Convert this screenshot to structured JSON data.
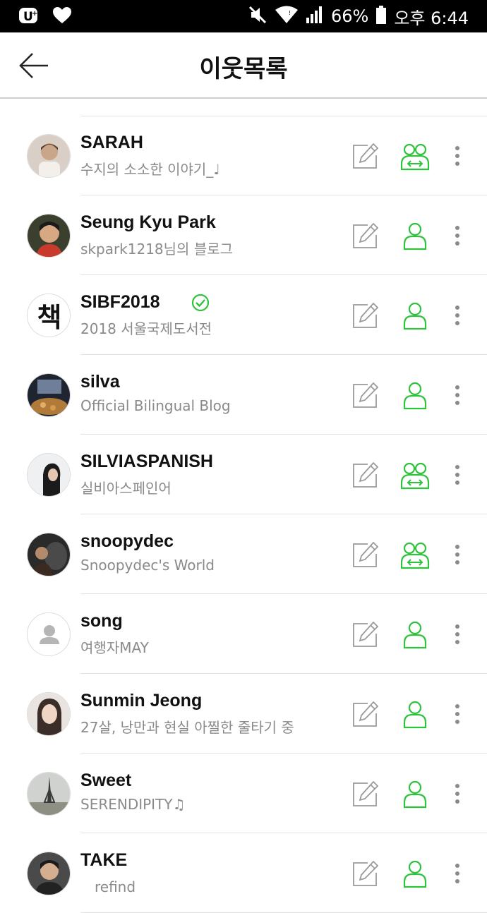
{
  "status_bar": {
    "battery": "66%",
    "time": "오후 6:44"
  },
  "header": {
    "title": "이웃목록"
  },
  "colors": {
    "accent_green": "#2fc23d",
    "icon_gray": "#9a9a9a"
  },
  "neighbors": [
    {
      "name": "SARAH",
      "desc": "수지의 소소한 이야기_♩",
      "relation": "mutual"
    },
    {
      "name": "Seung Kyu Park",
      "desc": "skpark1218님의 블로그",
      "relation": "single"
    },
    {
      "name": "SIBF2018",
      "desc": "2018 서울국제도서전",
      "relation": "single",
      "verified": true
    },
    {
      "name": "silva",
      "desc": "Official Bilingual Blog",
      "relation": "single"
    },
    {
      "name": "SILVIASPANISH",
      "desc": "실비아스페인어",
      "relation": "mutual"
    },
    {
      "name": "snoopydec",
      "desc": "Snoopydec's World",
      "relation": "mutual"
    },
    {
      "name": "song",
      "desc": "여행자MAY",
      "relation": "single"
    },
    {
      "name": "Sunmin Jeong",
      "desc": "27살, 낭만과 현실 아찔한 줄타기 중",
      "relation": "single"
    },
    {
      "name": "Sweet",
      "desc": "SERENDIPITY♫",
      "relation": "single"
    },
    {
      "name": "TAKE",
      "desc": "　refind",
      "relation": "single"
    }
  ],
  "avatar_texts": {
    "sibf": "책"
  }
}
